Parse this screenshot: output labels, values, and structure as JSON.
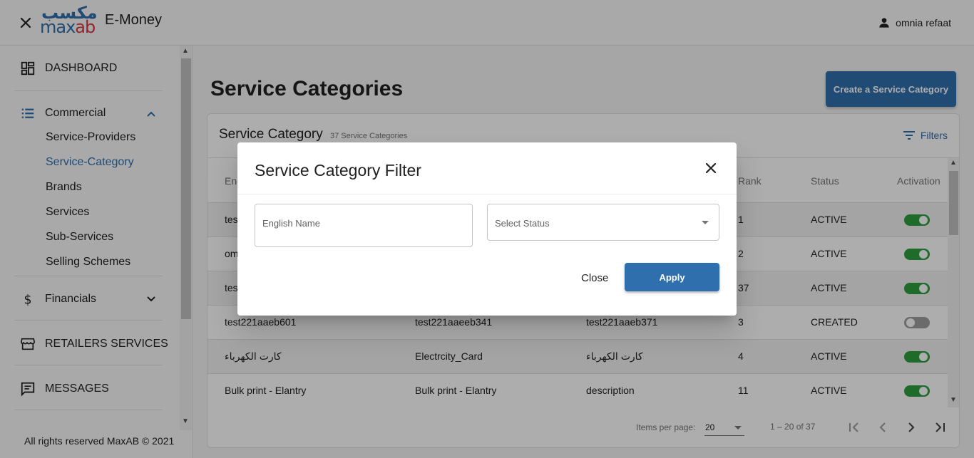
{
  "header": {
    "logo_ar": "مكسب",
    "logo_en_part1": "max",
    "logo_en_part2": "ab",
    "app_title": "E-Money",
    "user_name": "omnia refaat"
  },
  "sidebar": {
    "dashboard": "DASHBOARD",
    "commercial": "Commercial",
    "commercial_items": [
      "Service-Providers",
      "Service-Category",
      "Brands",
      "Services",
      "Sub-Services",
      "Selling Schemes"
    ],
    "financials": "Financials",
    "retailers_services": "RETAILERS SERVICES",
    "messages": "MESSAGES",
    "footer": "All rights reserved MaxAB © 2021"
  },
  "main": {
    "page_title": "Service Categories",
    "create_button": "Create a Service Category",
    "card_title": "Service Category",
    "card_count": "37 Service Categories",
    "filters_label": "Filters",
    "columns": [
      "Eng",
      "Rank",
      "Status",
      "Activation"
    ],
    "rows": [
      {
        "c1": "tes",
        "c2": "",
        "c3": "",
        "rank": "1",
        "status": "ACTIVE",
        "active": true
      },
      {
        "c1": "om",
        "c2": "",
        "c3": "",
        "rank": "2",
        "status": "ACTIVE",
        "active": true
      },
      {
        "c1": "tes",
        "c2": "",
        "c3": "",
        "rank": "37",
        "status": "ACTIVE",
        "active": true
      },
      {
        "c1": "test221aaeb601",
        "c2": "test221aaeeb341",
        "c3": "test221aaeb371",
        "rank": "3",
        "status": "CREATED",
        "active": false
      },
      {
        "c1": "كارت الكهرباء",
        "c2": "Electrcity_Card",
        "c3": "كارت الكهرباء",
        "rank": "4",
        "status": "ACTIVE",
        "active": true
      },
      {
        "c1": "Bulk print - Elantry",
        "c2": "Bulk print - Elantry",
        "c3": "description",
        "rank": "11",
        "status": "ACTIVE",
        "active": true
      }
    ],
    "pager": {
      "items_per_page_label": "Items per page:",
      "items_per_page_value": "20",
      "range": "1 – 20 of 37"
    }
  },
  "dialog": {
    "title": "Service Category Filter",
    "english_name_placeholder": "English Name",
    "status_placeholder": "Select Status",
    "close_label": "Close",
    "apply_label": "Apply"
  },
  "colors": {
    "primary": "#2f6fad",
    "toggle_on": "#2e9e3e",
    "toggle_off": "#9e9e9e"
  }
}
